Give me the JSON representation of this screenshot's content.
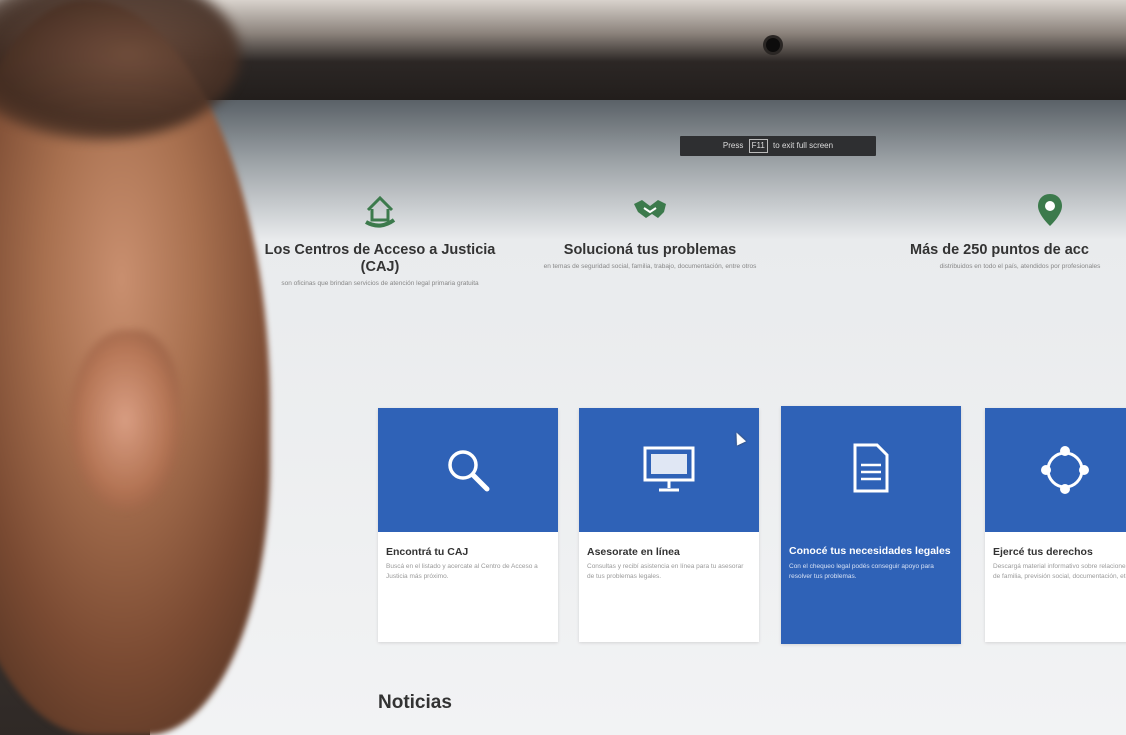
{
  "browser": {
    "fullscreen_prefix": "Press",
    "fullscreen_key": "F11",
    "fullscreen_suffix": "to exit full screen"
  },
  "features": [
    {
      "icon": "home-hands-icon",
      "title": "Los Centros de Acceso a Justicia (CAJ)",
      "desc": "son oficinas que brindan servicios de atención legal primaria gratuita"
    },
    {
      "icon": "handshake-icon",
      "title": "Solucioná tus problemas",
      "desc": "en temas de seguridad social, familia, trabajo, documentación, entre otros"
    },
    {
      "icon": "location-pin-icon",
      "title": "Más de 250 puntos de acc",
      "desc": "distribuidos en todo el país, atendidos por profesionales"
    }
  ],
  "cards": [
    {
      "icon": "search-icon",
      "title": "Encontrá tu CAJ",
      "desc": "Buscá en el listado y acercate al Centro de Acceso a Justicia más próximo.",
      "active": false
    },
    {
      "icon": "computer-icon",
      "title": "Asesorate en línea",
      "desc": "Consultas y recibí asistencia en línea para tu asesorar de tus problemas legales.",
      "active": false
    },
    {
      "icon": "document-icon",
      "title": "Conocé tus necesidades legales",
      "desc": "Con el chequeo legal podés conseguir apoyo para resolver tus problemas.",
      "active": true
    },
    {
      "icon": "network-icon",
      "title": "Ejercé tus derechos",
      "desc": "Descargá material informativo sobre relaciones de familia, previsión social, documentación, etc.",
      "active": false
    }
  ],
  "sections": {
    "news_title": "Noticias"
  },
  "colors": {
    "brand_blue": "#2f62b7",
    "icon_green": "#3c7a4c"
  }
}
